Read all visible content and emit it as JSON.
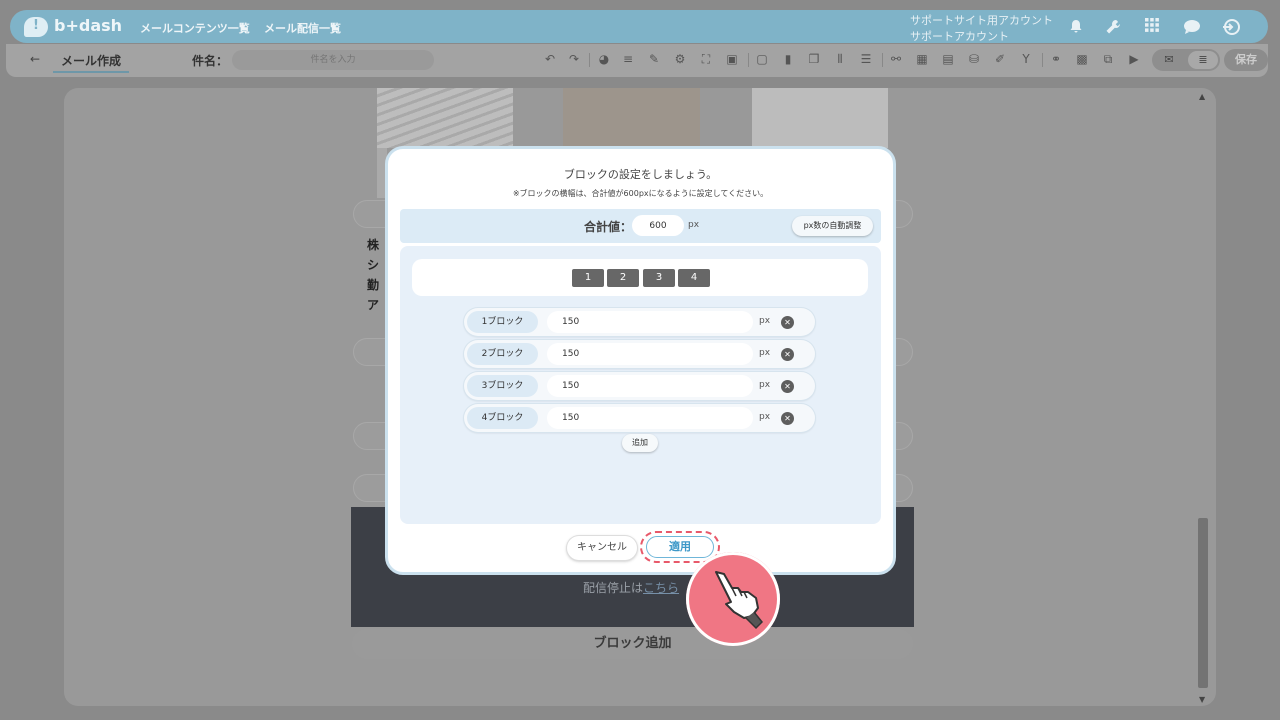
{
  "header": {
    "logo_text": "b+dash",
    "nav": [
      "メールコンテンツ一覧",
      "メール配信一覧"
    ],
    "account_line1": "サポートサイト用アカウント",
    "account_line2": "サポートアカウント"
  },
  "toolbar": {
    "page_title": "メール作成",
    "subject_label": "件名：",
    "subject_placeholder": "件名を入力",
    "save_label": "保存"
  },
  "background": {
    "text_fragments": [
      "株",
      "シ",
      "勤",
      "ア"
    ],
    "unsubscribe_prefix": "配信停止は",
    "unsubscribe_link": "こちら",
    "add_block_label": "ブロック追加"
  },
  "modal": {
    "title": "ブロックの設定をしましょう。",
    "note": "※ブロックの横幅は、合計値が600pxになるように設定してください。",
    "total_label": "合計値：",
    "total_value": "600",
    "total_unit": "px",
    "auto_adjust_label": "px数の自動調整",
    "count_options": [
      "1",
      "2",
      "3",
      "4"
    ],
    "blocks": [
      {
        "label": "1ブロック",
        "value": "150",
        "unit": "px"
      },
      {
        "label": "2ブロック",
        "value": "150",
        "unit": "px"
      },
      {
        "label": "3ブロック",
        "value": "150",
        "unit": "px"
      },
      {
        "label": "4ブロック",
        "value": "150",
        "unit": "px"
      }
    ],
    "add_label": "追加",
    "cancel_label": "キャンセル",
    "apply_label": "適用"
  },
  "colors": {
    "header_blue": "#4ab5e3",
    "modal_border": "#cbe1ee",
    "apply_highlight": "#e8596a",
    "pointer_circle": "#f07684"
  }
}
